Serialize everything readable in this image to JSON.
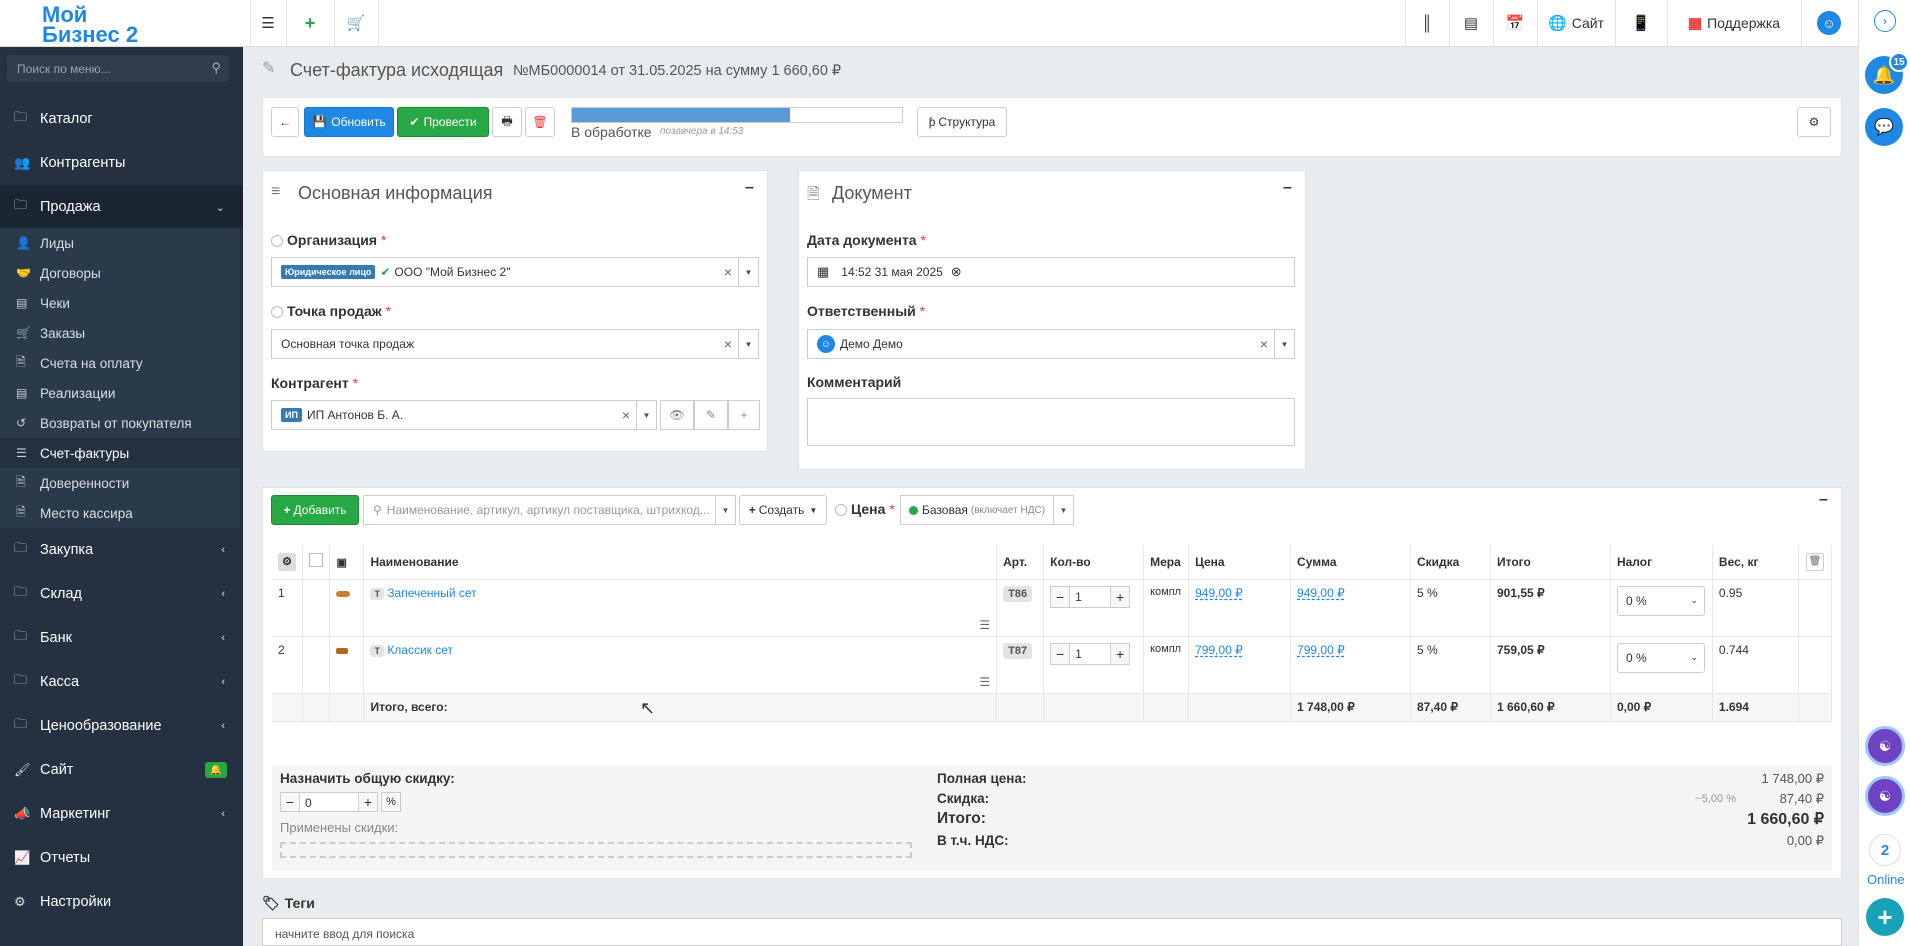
{
  "topbar": {
    "logo_text": "Мой Бизнес 2",
    "site_label": "Сайт",
    "support_label": "Поддержка"
  },
  "sidebar": {
    "search_placeholder": "Поиск по меню...",
    "items": [
      {
        "label": "Каталог"
      },
      {
        "label": "Контрагенты"
      },
      {
        "label": "Продажа"
      },
      {
        "label": "Закупка"
      },
      {
        "label": "Склад"
      },
      {
        "label": "Банк"
      },
      {
        "label": "Касса"
      },
      {
        "label": "Ценообразование"
      },
      {
        "label": "Сайт"
      },
      {
        "label": "Маркетинг"
      },
      {
        "label": "Отчеты"
      },
      {
        "label": "Настройки"
      }
    ],
    "sub_items": [
      {
        "label": "Лиды"
      },
      {
        "label": "Договоры"
      },
      {
        "label": "Чеки"
      },
      {
        "label": "Заказы"
      },
      {
        "label": "Счета на оплату"
      },
      {
        "label": "Реализации"
      },
      {
        "label": "Возвраты от покупателя"
      },
      {
        "label": "Счет-фактуры"
      },
      {
        "label": "Доверенности"
      },
      {
        "label": "Место кассира"
      }
    ]
  },
  "page": {
    "title": "Счет-фактура исходящая",
    "subtitle": "№МБ0000014 от 31.05.2025 на сумму 1 660,60 ₽"
  },
  "toolbar": {
    "update_label": "Обновить",
    "post_label": "Провести",
    "status": "В обработке",
    "status_time": "позавчера в 14:53",
    "progress": 0.66,
    "structure_label": "Структура"
  },
  "main_info": {
    "title": "Основная информация",
    "org_label": "Организация",
    "org_tag": "Юридическое лицо",
    "org_value": "ООО \"Мой Бизнес 2\"",
    "point_label": "Точка продаж",
    "point_value": "Основная точка продаж",
    "contractor_label": "Контрагент",
    "contractor_tag": "ИП",
    "contractor_value": "ИП Антонов Б. А."
  },
  "document": {
    "title": "Документ",
    "date_label": "Дата документа",
    "date_value": "14:52 31 мая 2025",
    "resp_label": "Ответственный",
    "resp_value": "Демо Демо",
    "comment_label": "Комментарий"
  },
  "items_panel": {
    "add_label": "Добавить",
    "search_placeholder": "Наименование, артикул, артикул поставщика, штрихкод...",
    "create_label": "Создать",
    "price_label": "Цена",
    "price_value": "Базовая",
    "price_note": "(включает НДС)",
    "columns": [
      "Наименование",
      "Арт.",
      "Кол-во",
      "Мера",
      "Цена",
      "Сумма",
      "Скидка",
      "Итого",
      "Налог",
      "Вес, кг"
    ],
    "rows": [
      {
        "num": "1",
        "type": "Т",
        "name": "Запеченный сет",
        "art": "Т86",
        "qty": "1",
        "unit": "компл",
        "price": "949,00 ₽",
        "sum": "949,00 ₽",
        "discount": "5 %",
        "total": "901,55 ₽",
        "tax": "0 %",
        "weight": "0.95"
      },
      {
        "num": "2",
        "type": "Т",
        "name": "Классик сет",
        "art": "Т87",
        "qty": "1",
        "unit": "компл",
        "price": "799,00 ₽",
        "sum": "799,00 ₽",
        "discount": "5 %",
        "total": "759,05 ₽",
        "tax": "0 %",
        "weight": "0.744"
      }
    ],
    "totals": {
      "label": "Итого, всего:",
      "sum": "1 748,00 ₽",
      "discount": "87,40 ₽",
      "total": "1 660,60 ₽",
      "tax": "0,00 ₽",
      "weight": "1.694"
    }
  },
  "summary": {
    "discount_label": "Назначить общую скидку:",
    "discount_value": "0",
    "percent": "%",
    "applied_label": "Применены скидки:",
    "full_price_label": "Полная цена:",
    "full_price": "1 748,00 ₽",
    "discount_row_label": "Скидка:",
    "discount_pct": "~5,00 %",
    "discount_amount": "87,40 ₽",
    "total_label": "Итого:",
    "total": "1 660,60 ₽",
    "vat_label": "В т.ч. НДС:",
    "vat": "0,00 ₽"
  },
  "tags": {
    "title": "Теги",
    "placeholder": "начните ввод для поиска"
  },
  "rightbar": {
    "notif_count": "15",
    "online_count": "2",
    "online_label": "Online"
  }
}
